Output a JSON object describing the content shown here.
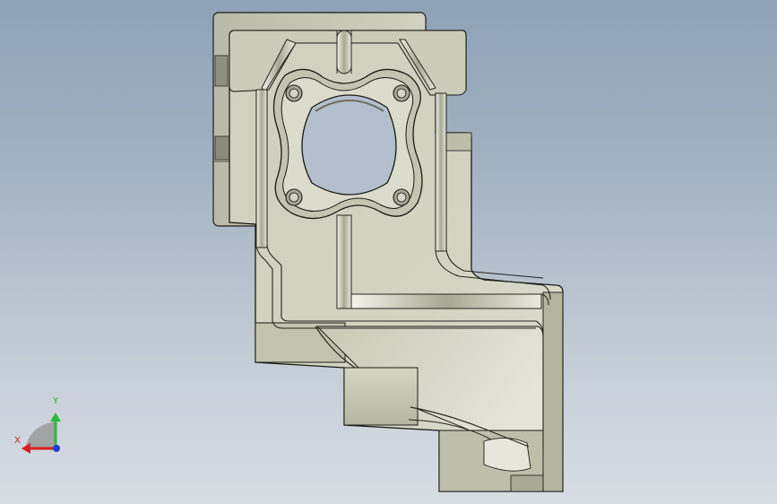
{
  "triad": {
    "x_label": "X",
    "y_label": "Y",
    "colors": {
      "x": "#d42020",
      "y": "#2cb83c",
      "z": "#2040d8"
    }
  },
  "model": {
    "colors": {
      "face_light": "#d8d9c8",
      "face_mid": "#c9cab7",
      "face_dark": "#9d9e8c",
      "edge": "#1a1a16"
    }
  }
}
